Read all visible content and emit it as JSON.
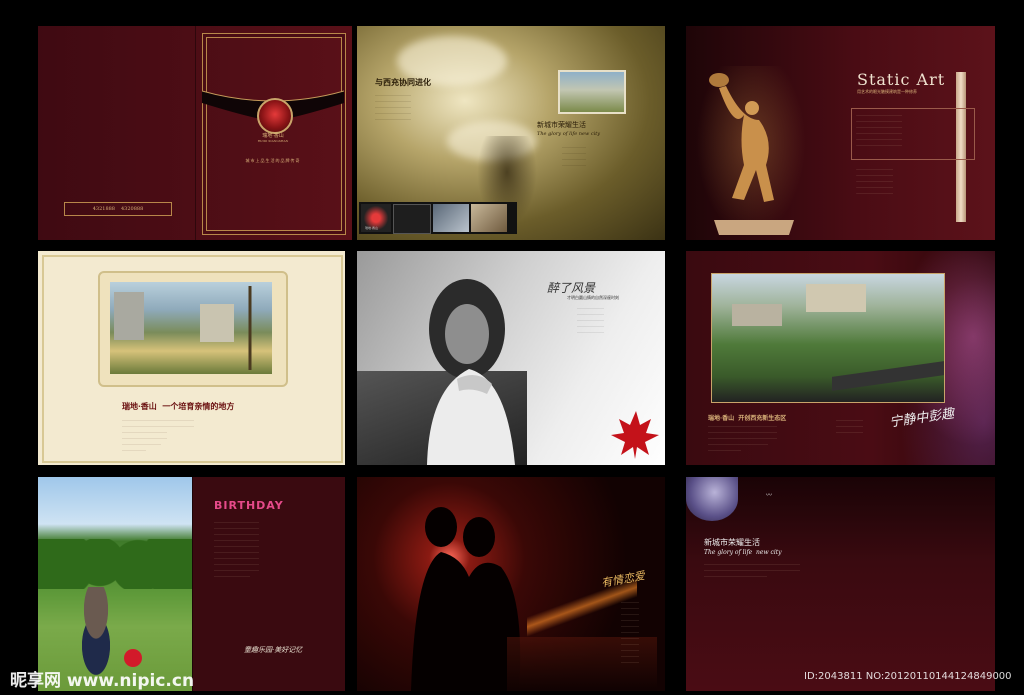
{
  "panel1": {
    "emblem_title": "瑞地·香山",
    "emblem_sub": "RUIDI XIANGSHAN",
    "slogan": "城市上品生活的品牌传奇",
    "phone_1": "4321888",
    "phone_2": "4320888"
  },
  "panel2": {
    "headline": "与西充协同进化",
    "sub_title": "新城市荣耀生活",
    "sub_en": "The glory of life new city",
    "strip_label": "瑞地·香山"
  },
  "panel3": {
    "title": "Static Art",
    "subtitle": "用艺术的眼光触摸建筑是一种修养"
  },
  "panel4": {
    "headline": "瑞地·香山  一个培育亲情的地方"
  },
  "panel5": {
    "script_title": "醉了风景",
    "sub_text": "才明白圆山情的自然深邃时刻"
  },
  "panel6": {
    "headline": "瑞地·香山  开创西充新生态区",
    "script": "宁静中彭趣"
  },
  "panel7": {
    "logo": "BIRTHDAY",
    "script": "童趣乐园·美好记忆"
  },
  "panel8": {
    "script": "有情恋爱"
  },
  "panel9": {
    "sub_title": "新城市荣耀生活",
    "sub_en": "The glory of life  new city"
  },
  "watermark": {
    "logo": "昵享网 www.nipic.cn",
    "id": "ID:2043811 NO:20120110144124849000"
  },
  "colors": {
    "maroon": "#4a0c14",
    "gold": "#d9b27a",
    "cream": "#f3ead0"
  }
}
